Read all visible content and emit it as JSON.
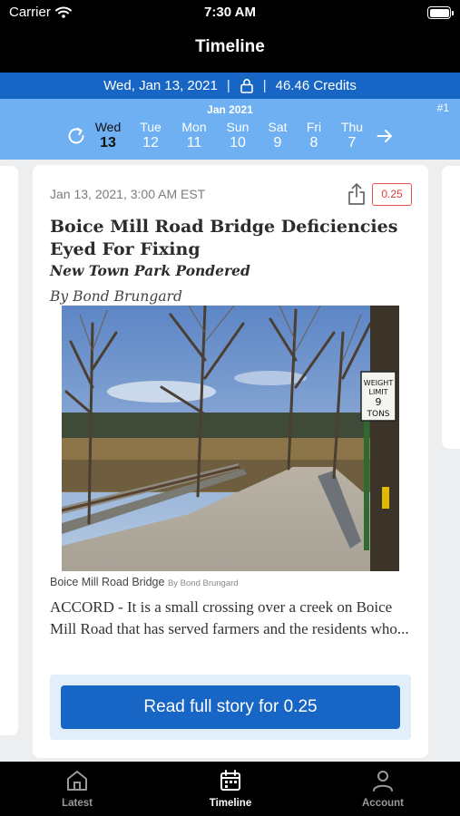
{
  "status_bar": {
    "carrier": "Carrier",
    "time": "7:30 AM"
  },
  "nav": {
    "title": "Timeline"
  },
  "credit_bar": {
    "date": "Wed, Jan 13, 2021",
    "separator": "|",
    "credits": "46.46 Credits"
  },
  "date_bar": {
    "month": "Jan 2021",
    "rank": "#1",
    "days": [
      {
        "name": "Wed",
        "num": "13",
        "active": true
      },
      {
        "name": "Tue",
        "num": "12"
      },
      {
        "name": "Mon",
        "num": "11"
      },
      {
        "name": "Sun",
        "num": "10"
      },
      {
        "name": "Sat",
        "num": "9"
      },
      {
        "name": "Fri",
        "num": "8"
      },
      {
        "name": "Thu",
        "num": "7"
      }
    ]
  },
  "article": {
    "timestamp": "Jan 13, 2021, 3:00 AM EST",
    "price": "0.25",
    "headline": "Boice Mill Road Bridge Deficiencies Eyed For Fixing",
    "subhead": "New Town Park Pondered",
    "byline": "By Bond Brungard",
    "sign_text": [
      "WEIGHT",
      "LIMIT",
      "9",
      "TONS"
    ],
    "caption": "Boice Mill Road Bridge",
    "caption_credit": "By Bond Brungard",
    "excerpt": "ACCORD - It is a small crossing over a creek on Boice Mill Road that has served farmers and the residents who...",
    "cta_label": "Read full story for 0.25"
  },
  "tabs": [
    {
      "label": "Latest",
      "icon": "home-icon"
    },
    {
      "label": "Timeline",
      "icon": "calendar-icon",
      "active": true
    },
    {
      "label": "Account",
      "icon": "person-icon"
    }
  ],
  "colors": {
    "primary_blue": "#1765c5",
    "date_bar_blue": "#6fb0f3",
    "price_red": "#e03c3c"
  }
}
